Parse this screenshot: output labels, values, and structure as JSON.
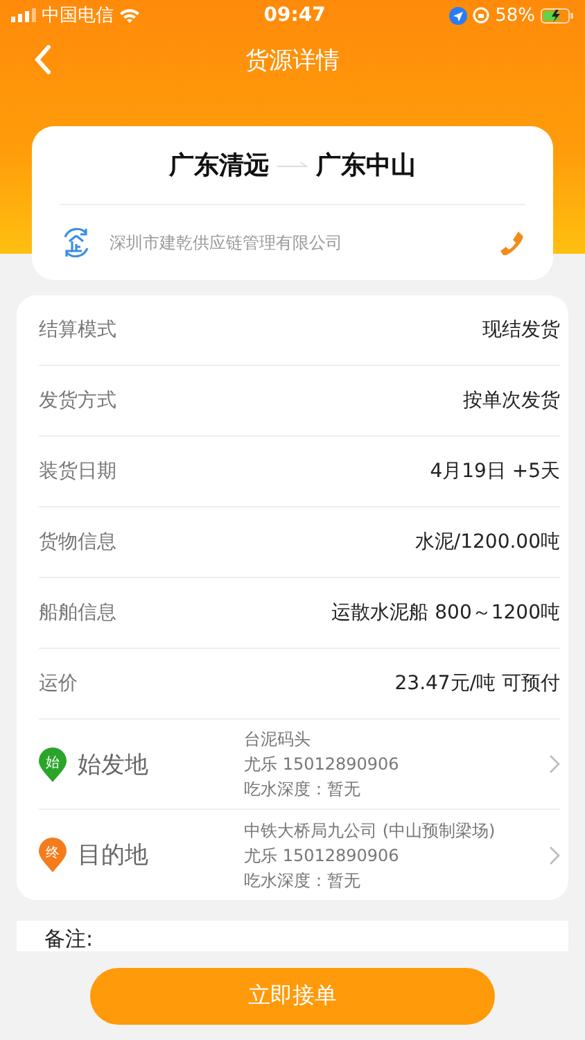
{
  "status_bar": {
    "carrier": "中国电信",
    "time": "09:47",
    "battery": "58%"
  },
  "nav": {
    "title": "货源详情"
  },
  "route": {
    "from": "广东清远",
    "to": "广东中山",
    "company": "深圳市建乾供应链管理有限公司"
  },
  "details": [
    {
      "label": "结算模式",
      "value": "现结发货"
    },
    {
      "label": "发货方式",
      "value": "按单次发货"
    },
    {
      "label": "装货日期",
      "value": "4月19日 +5天"
    },
    {
      "label": "货物信息",
      "value": "水泥/1200.00吨"
    },
    {
      "label": "船舶信息",
      "value": "运散水泥船 800～1200吨"
    },
    {
      "label": "运价",
      "value": "23.47元/吨 可预付"
    }
  ],
  "locations": [
    {
      "kind": "origin",
      "pin": "始",
      "label": "始发地",
      "place": "台泥码头",
      "contact": "尤乐  15012890906",
      "depth": "吃水深度：暂无"
    },
    {
      "kind": "destination",
      "pin": "终",
      "label": "目的地",
      "place": "中铁大桥局九公司 (中山预制梁场)",
      "contact": "尤乐  15012890906",
      "depth": "吃水深度：暂无"
    }
  ],
  "remarks": {
    "label": "备注:"
  },
  "action_button": "立即接单"
}
